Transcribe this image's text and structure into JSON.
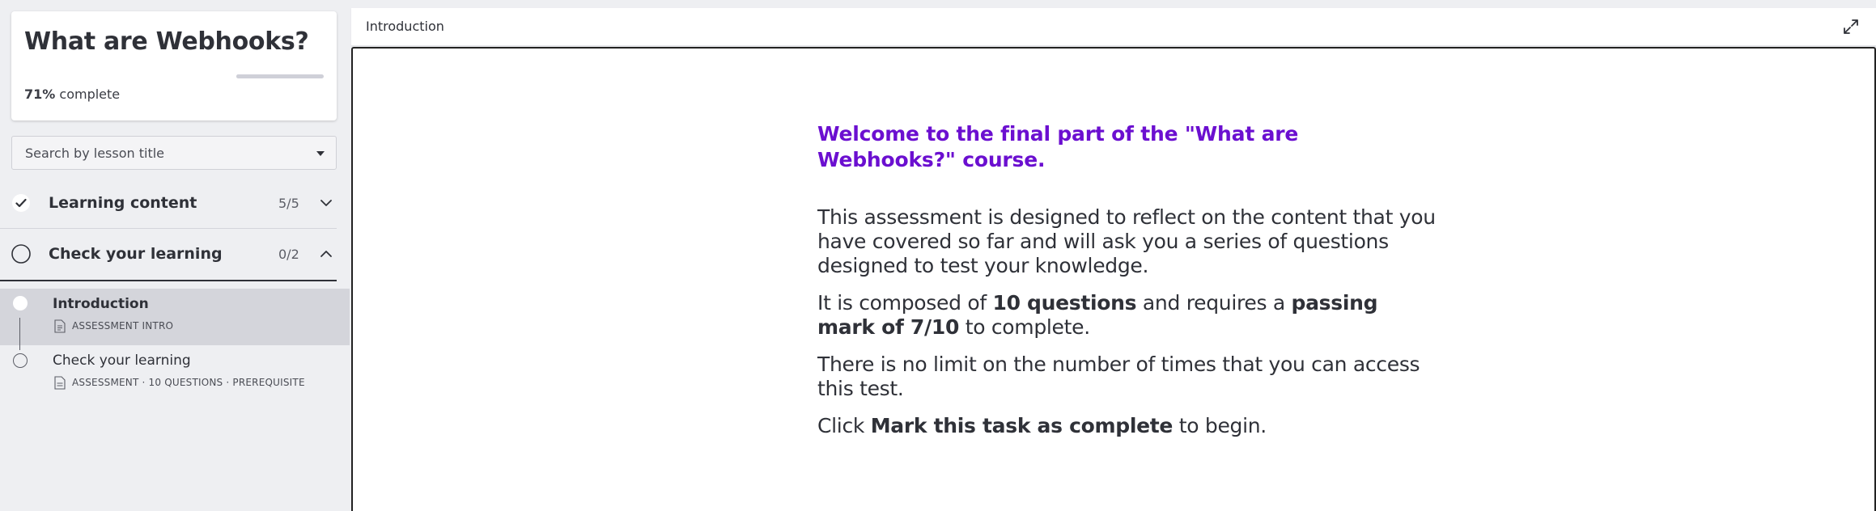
{
  "course": {
    "title": "What are Webhooks?",
    "progress_value": "71%",
    "progress_label": "complete",
    "progress_fraction": 0.71
  },
  "search": {
    "placeholder": "Search by lesson title"
  },
  "sections": [
    {
      "title": "Learning content",
      "count": "5/5",
      "status": "completed",
      "expanded": false
    },
    {
      "title": "Check your learning",
      "count": "0/2",
      "status": "not-started",
      "expanded": true
    }
  ],
  "lessons": [
    {
      "title": "Introduction",
      "meta": "ASSESSMENT INTRO",
      "selected": true,
      "icon": "document-icon"
    },
    {
      "title": "Check your learning",
      "meta": "ASSESSMENT · 10 QUESTIONS · PREREQUISITE",
      "selected": false,
      "icon": "quiz-document-icon"
    }
  ],
  "main": {
    "header_title": "Introduction",
    "content": {
      "heading": "Welcome to the final part of the \"What are Webhooks?\" course.",
      "p1": "This assessment is designed to reflect on the content that you have covered so far and will ask you a series of questions designed to test your knowledge.",
      "p2_a": "It is composed of ",
      "p2_b": "10 questions",
      "p2_c": " and requires a ",
      "p2_d": "passing mark of 7/10",
      "p2_e": " to complete.",
      "p3": "There is no limit on the number of times that you can access this test.",
      "p4_a": "Click ",
      "p4_b": "Mark this task as complete",
      "p4_c": " to begin."
    }
  },
  "colors": {
    "accent_purple": "#6b0fd0",
    "text_dark": "#2f3138",
    "sidebar_bg": "#eeeff2",
    "selected_bg": "#d4d5db"
  }
}
